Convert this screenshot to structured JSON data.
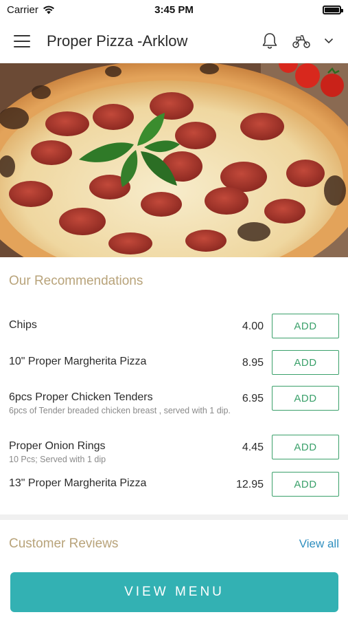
{
  "status_bar": {
    "carrier": "Carrier",
    "time": "3:45 PM"
  },
  "header": {
    "title": "Proper Pizza -Arklow",
    "icons": [
      "menu-icon",
      "bell-icon",
      "scooter-icon",
      "chevron-down-icon"
    ]
  },
  "recommendations": {
    "title": "Our Recommendations",
    "add_label": "ADD",
    "items": [
      {
        "name": "Chips",
        "description": "",
        "price": "4.00"
      },
      {
        "name": "10\" Proper Margherita Pizza",
        "description": "",
        "price": "8.95"
      },
      {
        "name": "6pcs Proper Chicken Tenders",
        "description": "6pcs of Tender breaded chicken breast , served with 1 dip.",
        "price": "6.95"
      },
      {
        "name": "Proper Onion Rings",
        "description": "10 Pcs; Served with 1 dip",
        "price": "4.45"
      },
      {
        "name": "13\" Proper Margherita Pizza",
        "description": "",
        "price": "12.95"
      }
    ]
  },
  "reviews": {
    "title": "Customer Reviews",
    "view_all_label": "View all"
  },
  "footer": {
    "view_menu_label": "VIEW MENU"
  },
  "colors": {
    "accent_title": "#b8a37a",
    "add_green": "#3aa06a",
    "link_blue": "#2f8fbf",
    "cta_teal": "#33b1b3"
  }
}
